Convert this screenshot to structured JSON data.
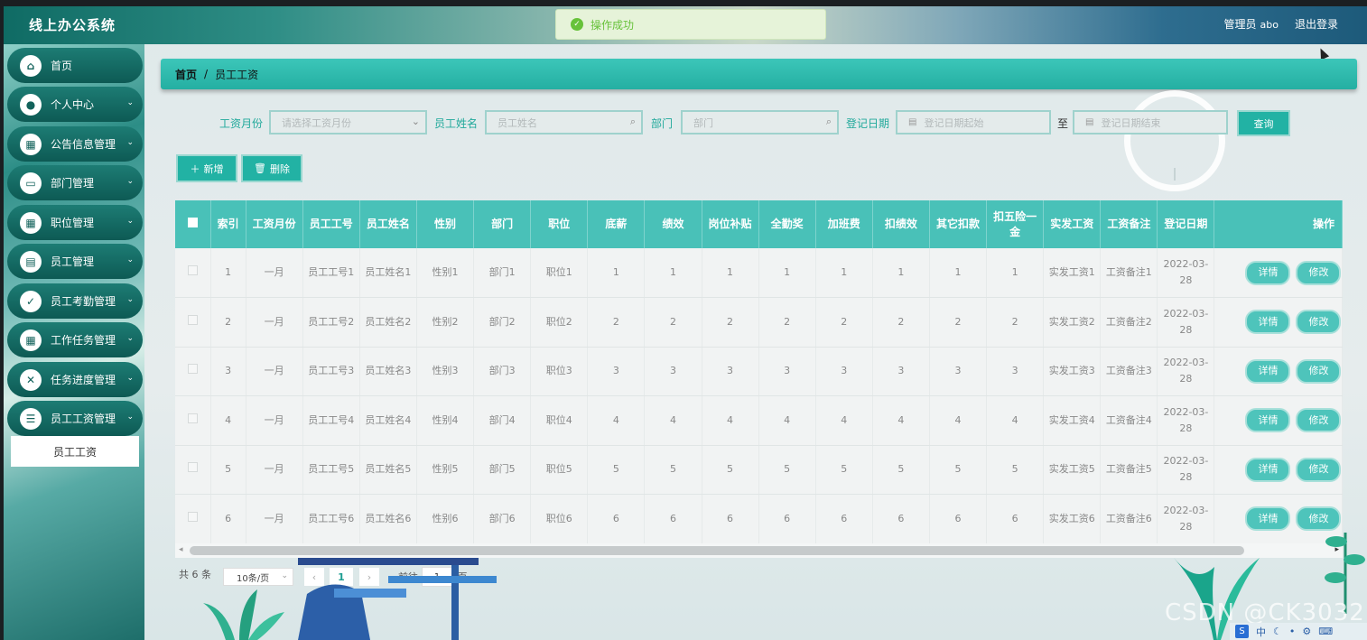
{
  "app": {
    "title": "线上办公系统"
  },
  "toast": {
    "message": "操作成功"
  },
  "header": {
    "role": "管理员",
    "username": "abo",
    "logout": "退出登录"
  },
  "sidebar": {
    "items": [
      {
        "label": "首页",
        "icon": "home-icon",
        "glyph": "⌂"
      },
      {
        "label": "个人中心",
        "icon": "user-icon",
        "glyph": "●"
      },
      {
        "label": "公告信息管理",
        "icon": "grid-icon",
        "glyph": "▦"
      },
      {
        "label": "部门管理",
        "icon": "monitor-icon",
        "glyph": "▭"
      },
      {
        "label": "职位管理",
        "icon": "grid-icon",
        "glyph": "▦"
      },
      {
        "label": "员工管理",
        "icon": "clipboard-icon",
        "glyph": "▤"
      },
      {
        "label": "员工考勤管理",
        "icon": "clipboard-check-icon",
        "glyph": "✓"
      },
      {
        "label": "工作任务管理",
        "icon": "grid-icon",
        "glyph": "▦"
      },
      {
        "label": "任务进度管理",
        "icon": "clipboard-x-icon",
        "glyph": "✕"
      },
      {
        "label": "员工工资管理",
        "icon": "sliders-icon",
        "glyph": "☰"
      }
    ],
    "active_sub": "员工工资"
  },
  "breadcrumb": {
    "home": "首页",
    "sep": "/",
    "current": "员工工资"
  },
  "filters": {
    "month_label": "工资月份",
    "month_placeholder": "请选择工资月份",
    "name_label": "员工姓名",
    "name_placeholder": "员工姓名",
    "dept_label": "部门",
    "dept_placeholder": "部门",
    "date_label": "登记日期",
    "date_start_placeholder": "登记日期起始",
    "date_to": "至",
    "date_end_placeholder": "登记日期结束",
    "query": "查询"
  },
  "actions": {
    "add": "新增",
    "delete": "删除"
  },
  "table": {
    "headers": [
      "索引",
      "工资月份",
      "员工工号",
      "员工姓名",
      "性别",
      "部门",
      "职位",
      "底薪",
      "绩效",
      "岗位补贴",
      "全勤奖",
      "加班费",
      "扣绩效",
      "其它扣款",
      "扣五险一金",
      "实发工资",
      "工资备注",
      "登记日期",
      "操作"
    ],
    "rows": [
      [
        "1",
        "一月",
        "员工工号1",
        "员工姓名1",
        "性别1",
        "部门1",
        "职位1",
        "1",
        "1",
        "1",
        "1",
        "1",
        "1",
        "1",
        "1",
        "实发工资1",
        "工资备注1",
        "2022-03-28"
      ],
      [
        "2",
        "一月",
        "员工工号2",
        "员工姓名2",
        "性别2",
        "部门2",
        "职位2",
        "2",
        "2",
        "2",
        "2",
        "2",
        "2",
        "2",
        "2",
        "实发工资2",
        "工资备注2",
        "2022-03-28"
      ],
      [
        "3",
        "一月",
        "员工工号3",
        "员工姓名3",
        "性别3",
        "部门3",
        "职位3",
        "3",
        "3",
        "3",
        "3",
        "3",
        "3",
        "3",
        "3",
        "实发工资3",
        "工资备注3",
        "2022-03-28"
      ],
      [
        "4",
        "一月",
        "员工工号4",
        "员工姓名4",
        "性别4",
        "部门4",
        "职位4",
        "4",
        "4",
        "4",
        "4",
        "4",
        "4",
        "4",
        "4",
        "实发工资4",
        "工资备注4",
        "2022-03-28"
      ],
      [
        "5",
        "一月",
        "员工工号5",
        "员工姓名5",
        "性别5",
        "部门5",
        "职位5",
        "5",
        "5",
        "5",
        "5",
        "5",
        "5",
        "5",
        "5",
        "实发工资5",
        "工资备注5",
        "2022-03-28"
      ],
      [
        "6",
        "一月",
        "员工工号6",
        "员工姓名6",
        "性别6",
        "部门6",
        "职位6",
        "6",
        "6",
        "6",
        "6",
        "6",
        "6",
        "6",
        "6",
        "实发工资6",
        "工资备注6",
        "2022-03-28"
      ]
    ],
    "op_detail": "详情",
    "op_edit": "修改"
  },
  "pagination": {
    "total": "共 6 条",
    "page_size": "10条/页",
    "current_page": "1",
    "goto_label": "前往",
    "goto_value": "1",
    "page_unit": "页"
  },
  "watermark": "CSDN @CK3032",
  "tray": {
    "ime": "中"
  },
  "colors": {
    "accent": "#22b2a4",
    "header_row": "#49c1b8",
    "success": "#67c23a"
  }
}
